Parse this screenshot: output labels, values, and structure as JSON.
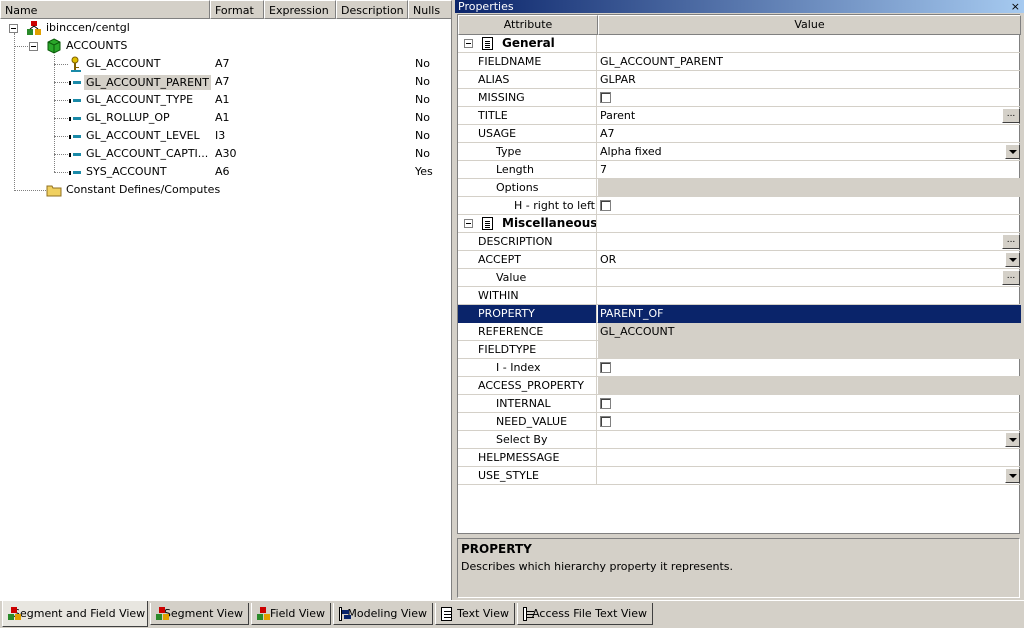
{
  "tree": {
    "columns": [
      "Name",
      "Format",
      "Expression",
      "Description",
      "Nulls"
    ],
    "root": {
      "label": "ibinccen/centgl"
    },
    "segment": {
      "label": "ACCOUNTS"
    },
    "fields": [
      {
        "name": "GL_ACCOUNT",
        "format": "A7",
        "nulls": "No",
        "key": true
      },
      {
        "name": "GL_ACCOUNT_PARENT",
        "format": "A7",
        "nulls": "No",
        "selected": true
      },
      {
        "name": "GL_ACCOUNT_TYPE",
        "format": "A1",
        "nulls": "No"
      },
      {
        "name": "GL_ROLLUP_OP",
        "format": "A1",
        "nulls": "No"
      },
      {
        "name": "GL_ACCOUNT_LEVEL",
        "format": "I3",
        "nulls": "No"
      },
      {
        "name": "GL_ACCOUNT_CAPTI...",
        "format": "A30",
        "nulls": "No"
      },
      {
        "name": "SYS_ACCOUNT",
        "format": "A6",
        "nulls": "Yes"
      }
    ],
    "constants": {
      "label": "Constant Defines/Computes"
    }
  },
  "properties": {
    "title": "Properties",
    "close": "×",
    "headers": {
      "attribute": "Attribute",
      "value": "Value"
    },
    "rows": [
      {
        "type": "category",
        "label": "General"
      },
      {
        "label": "FIELDNAME",
        "value": "GL_ACCOUNT_PARENT",
        "indent": 0
      },
      {
        "label": "ALIAS",
        "value": "GLPAR",
        "indent": 0
      },
      {
        "label": "MISSING",
        "control": "checkbox",
        "indent": 0
      },
      {
        "label": "TITLE",
        "value": "Parent",
        "control": "dots",
        "indent": 0
      },
      {
        "label": "USAGE",
        "value": "A7",
        "indent": 0
      },
      {
        "label": "Type",
        "value": "Alpha fixed",
        "control": "dropdown",
        "indent": 1
      },
      {
        "label": "Length",
        "value": "7",
        "indent": 1
      },
      {
        "label": "Options",
        "value": "",
        "gray": true,
        "indent": 1
      },
      {
        "label": "H - right to left",
        "control": "checkbox",
        "indent": 2
      },
      {
        "type": "category",
        "label": "Miscellaneous"
      },
      {
        "label": "DESCRIPTION",
        "value": "",
        "control": "dots",
        "indent": 0
      },
      {
        "label": "ACCEPT",
        "value": "OR",
        "control": "dropdown",
        "indent": 0
      },
      {
        "label": "Value",
        "value": "",
        "control": "dots",
        "indent": 1
      },
      {
        "label": "WITHIN",
        "value": "",
        "indent": 0
      },
      {
        "label": "PROPERTY",
        "value": "PARENT_OF",
        "selected": true,
        "indent": 0
      },
      {
        "label": "REFERENCE",
        "value": "GL_ACCOUNT",
        "gray": true,
        "indent": 0
      },
      {
        "label": "FIELDTYPE",
        "value": "",
        "gray": true,
        "indent": 0
      },
      {
        "label": "I - Index",
        "control": "checkbox",
        "indent": 1
      },
      {
        "label": "ACCESS_PROPERTY",
        "value": "",
        "gray": true,
        "indent": 0
      },
      {
        "label": "INTERNAL",
        "control": "checkbox",
        "indent": 1
      },
      {
        "label": "NEED_VALUE",
        "control": "checkbox",
        "indent": 1
      },
      {
        "label": "Select By",
        "value": "",
        "control": "dropdown",
        "indent": 1
      },
      {
        "label": "HELPMESSAGE",
        "value": "",
        "indent": 0
      },
      {
        "label": "USE_STYLE",
        "value": "",
        "control": "dropdown",
        "indent": 0
      }
    ],
    "description": {
      "title": "PROPERTY",
      "text": "Describes which hierarchy property it represents."
    }
  },
  "tabs": [
    {
      "label": "Segment and Field View",
      "icon": "segment-icon",
      "active": true
    },
    {
      "label": "Segment View",
      "icon": "segment-icon"
    },
    {
      "label": "Field View",
      "icon": "segment-icon"
    },
    {
      "label": "Modeling View",
      "icon": "modeling-icon"
    },
    {
      "label": "Text View",
      "icon": "text-icon"
    },
    {
      "label": "Access File Text View",
      "icon": "text-icon"
    }
  ]
}
